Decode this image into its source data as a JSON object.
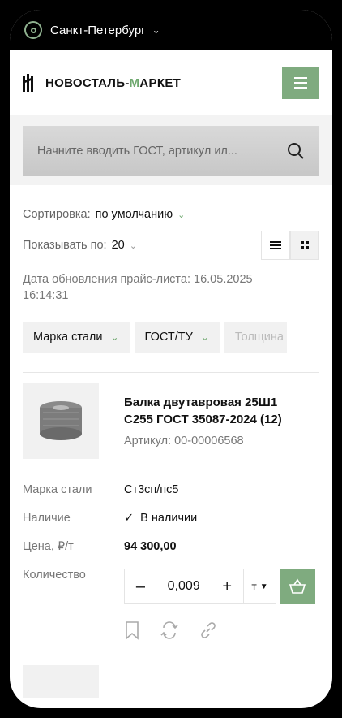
{
  "topbar": {
    "city": "Санкт-Петербург",
    "icon": "location-pin-icon"
  },
  "header": {
    "logo_part1": "НОВОСТАЛЬ-",
    "logo_part2": "М",
    "logo_part3": "АРКЕТ"
  },
  "search": {
    "placeholder": "Начните вводить ГОСТ, артикул ил..."
  },
  "sorting": {
    "label": "Сортировка:",
    "value": "по умолчанию"
  },
  "per_page": {
    "label": "Показывать по:",
    "value": "20"
  },
  "price_date": {
    "line1": "Дата обновления прайс-листа: 16.05.2025",
    "line2": "16:14:31"
  },
  "filters": [
    "Марка стали",
    "ГОСТ/ТУ",
    "Толщина"
  ],
  "product": {
    "title_line1": "Балка двутавровая 25Ш1",
    "title_line2": "С255 ГОСТ 35087-2024 (12)",
    "sku": "Артикул: 00-00006568",
    "specs": {
      "grade_label": "Марка стали",
      "grade_value": "Ст3сп/пс5",
      "stock_label": "Наличие",
      "stock_value": "В наличии",
      "price_label": "Цена, ₽/т",
      "price_value": "94 300,00",
      "qty_label": "Количество"
    },
    "quantity": "0,009",
    "unit": "т"
  },
  "colors": {
    "accent": "#7fab7f",
    "accent_text": "#6ea86e"
  }
}
